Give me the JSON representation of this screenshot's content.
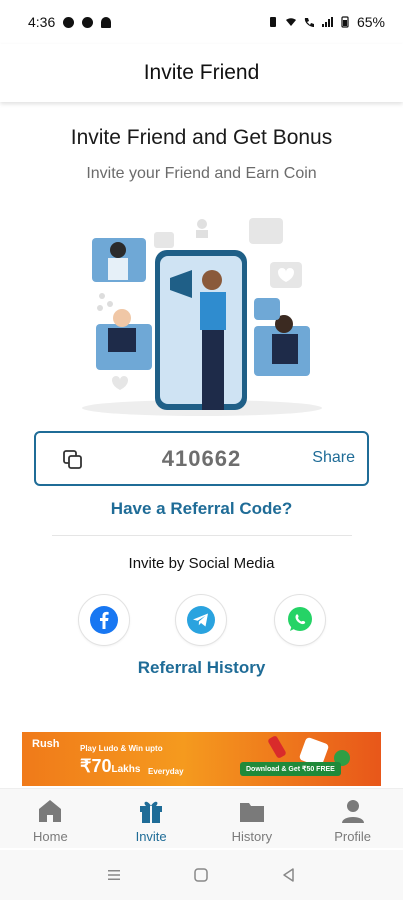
{
  "status_bar": {
    "time": "4:36",
    "battery": "65%"
  },
  "header": {
    "title": "Invite Friend"
  },
  "main": {
    "headline": "Invite Friend and Get Bonus",
    "subheadline": "Invite your Friend and Earn Coin",
    "referral_code": "410662",
    "share_label": "Share",
    "have_referral_label": "Have a Referral Code?",
    "invite_social_label": "Invite by Social Media",
    "social": [
      "facebook-icon",
      "telegram-icon",
      "whatsapp-icon"
    ],
    "referral_history_label": "Referral History"
  },
  "ad": {
    "brand": "Rush",
    "line1": "Play Ludo & Win upto",
    "amount": "₹70",
    "amount_suffix": "Lakhs",
    "line2": "Everyday",
    "cta": "Download & Get ₹50 FREE"
  },
  "bottom_nav": {
    "items": [
      {
        "label": "Home"
      },
      {
        "label": "Invite"
      },
      {
        "label": "History"
      },
      {
        "label": "Profile"
      }
    ],
    "active": "Invite"
  },
  "colors": {
    "accent": "#1f6c97",
    "facebook": "#1877f2",
    "telegram": "#2aa3df",
    "whatsapp": "#25d366"
  }
}
